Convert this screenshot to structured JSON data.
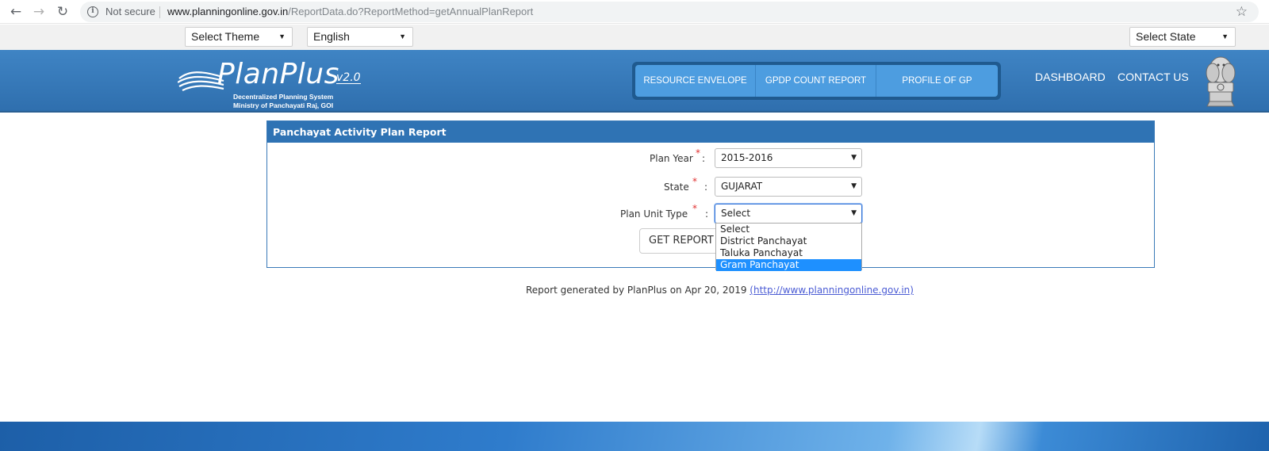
{
  "browser": {
    "back_icon": "←",
    "forward_icon": "→",
    "reload_icon": "↻",
    "security_label": "Not secure",
    "url_host": "www.planningonline.gov.in",
    "url_path": "/ReportData.do?ReportMethod=getAnnualPlanReport",
    "star_icon": "☆"
  },
  "selectors": {
    "theme": "Select Theme",
    "language": "English",
    "state": "Select State"
  },
  "header": {
    "logo_title": "PlanPlus",
    "logo_version": "v2.0",
    "logo_sub1": "Decentralized Planning System",
    "logo_sub2": "Ministry of Panchayati Raj, GOI",
    "menu": [
      "RESOURCE ENVELOPE",
      "GPDP COUNT REPORT",
      "PROFILE OF GP"
    ],
    "dashboard": "DASHBOARD",
    "contact": "CONTACT US"
  },
  "report": {
    "title": "Panchayat Activity Plan Report",
    "plan_year_label": "Plan Year",
    "plan_year_value": "2015-2016",
    "state_label": "State",
    "state_value": "GUJARAT",
    "unit_type_label": "Plan Unit Type",
    "unit_type_value": "Select",
    "required_mark": "*",
    "colon": ":",
    "unit_type_options": [
      "Select",
      "District Panchayat",
      "Taluka Panchayat",
      "Gram Panchayat"
    ],
    "unit_type_highlighted": "Gram Panchayat",
    "get_report_label": "GET REPORT"
  },
  "footer": {
    "text": "Report generated by PlanPlus on Apr 20, 2019 ",
    "link": "(http://www.planningonline.gov.in)"
  },
  "colors": {
    "header_blue": "#2f73b4",
    "menu_blue": "#4d9de0",
    "highlight": "#1e90ff",
    "required": "#e03030"
  }
}
